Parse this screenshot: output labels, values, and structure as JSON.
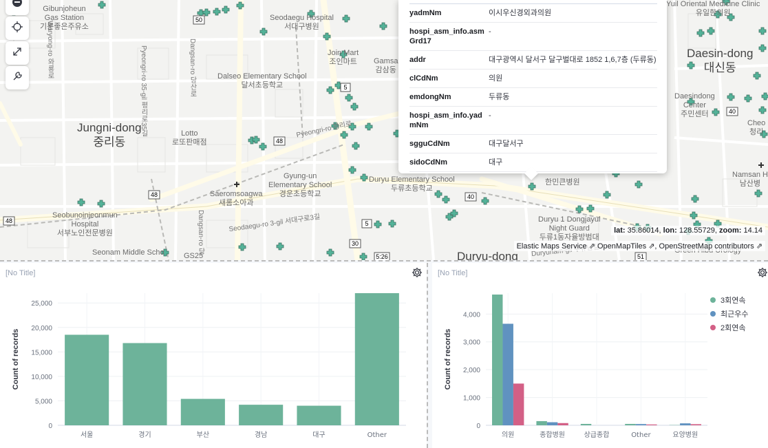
{
  "map": {
    "districts": [
      {
        "id": "jungni",
        "en": "Jungni-dong",
        "ko": "중리동"
      },
      {
        "id": "daesin",
        "en": "Daesin-dong",
        "ko": "대신동"
      },
      {
        "id": "duryu",
        "en": "Duryu-dong",
        "ko": ""
      }
    ],
    "places": [
      {
        "id": "gibunjoheun",
        "text": "Gibunjoheun\nGas Station\n기분좋은주유소"
      },
      {
        "id": "seodaegu-hospital",
        "text": "Seodaegu Hospital\n서대구병원"
      },
      {
        "id": "join-mart",
        "text": "Join Mart\n조인마트"
      },
      {
        "id": "dalseo-elem",
        "text": "Dalseo Elementary School\n달서초등학교"
      },
      {
        "id": "lotto",
        "text": "Lotto\n로또판매점"
      },
      {
        "id": "gyung-un",
        "text": "Gyung-un\nElementary School\n경운초등학교"
      },
      {
        "id": "saeromsoagwa",
        "text": "Saeromsoagwa\n새롬소아과"
      },
      {
        "id": "seobunoin",
        "text": "Seobunoinjeonmun\nHospital\n서부노인전문병원"
      },
      {
        "id": "duryu-elem",
        "text": "Duryu Elementary School\n두류초등학교"
      },
      {
        "id": "seonam",
        "text": "Seonam Middle Scho"
      },
      {
        "id": "gs25",
        "text": "GS25"
      },
      {
        "id": "duryu1-guard",
        "text": "Duryu 1 Dongjayul\nNight Guard\n두류1동자율방범대"
      },
      {
        "id": "daesindong-center",
        "text": "Daesindong\nCenter\n주민센터"
      },
      {
        "id": "namsan",
        "text": "Namsan H\n남산병"
      },
      {
        "id": "oriental",
        "text": "Yuil Oriental Medicine Clinic\n유일한의원"
      },
      {
        "id": "cheon",
        "text": "Cheo\n청리"
      },
      {
        "id": "gamsam",
        "text": "Gamsa\n감삼동"
      },
      {
        "id": "hanmin",
        "text": "한민큰병원"
      },
      {
        "id": "green",
        "text": "Green Hibu Urology"
      }
    ],
    "roads": [
      {
        "id": "pyeongri-ro",
        "text": "Pyeongri-ro 35-gil 평리로35길"
      },
      {
        "id": "dangsan-ro",
        "text": "Dangsan-ro 당산로"
      },
      {
        "id": "waryong-ro",
        "text": "Waryong-ro 와룡로"
      },
      {
        "id": "seodaegu-ro-3gil",
        "text": "Seodaegu-ro 3-gil 서대구로3길"
      },
      {
        "id": "duryunam-gil",
        "text": "Duryunam-gil 두류남길"
      },
      {
        "id": "pyeongri-ro-main",
        "text": "Pyeongri-ro 평리로"
      },
      {
        "id": "dangsan-ro-b",
        "text": "Dangsan-ro 당"
      }
    ],
    "route_shields": [
      "50",
      "48",
      "48",
      "5",
      "5",
      "30",
      "40",
      "40",
      "48",
      "51",
      "5:26"
    ],
    "tooltip": {
      "rows": [
        {
          "key": "yadmNm",
          "value": "이시우신경외과의원"
        },
        {
          "key": "hospi_asm_info.asmGrd17",
          "value": "-"
        },
        {
          "key": "addr",
          "value": "대구광역시 달서구 달구벌대로 1852 1,6,7층 (두류동)"
        },
        {
          "key": "clCdNm",
          "value": "의원"
        },
        {
          "key": "emdongNm",
          "value": "두류동"
        },
        {
          "key": "hospi_asm_info.yadmNm",
          "value": "-"
        },
        {
          "key": "sgguCdNm",
          "value": "대구달서구"
        },
        {
          "key": "sidoCdNm",
          "value": "대구"
        }
      ]
    },
    "coords": {
      "lat_label": "lat:",
      "lat": "35.86014,",
      "lon_label": "lon:",
      "lon": "128.55729,",
      "zoom_label": "zoom:",
      "zoom": "14.14"
    },
    "attribution": [
      "Elastic Maps Service",
      "OpenMapTiles",
      "OpenStreetMap contributors"
    ],
    "controls": [
      "zoom-out-icon",
      "crosshair-icon",
      "expand-icon",
      "wrench-icon"
    ],
    "marker_color": "#54b399"
  },
  "panels": {
    "left": {
      "title": "[No Title]"
    },
    "right": {
      "title": "[No Title]"
    }
  },
  "chart_data": [
    {
      "type": "bar",
      "categories": [
        "서울",
        "경기",
        "부산",
        "경남",
        "대구",
        "Other"
      ],
      "values": [
        18500,
        16800,
        5400,
        4200,
        4000,
        27000
      ],
      "ylabel": "Count of records",
      "xlabel": "",
      "ylim": [
        0,
        27000
      ],
      "yticks": [
        0,
        5000,
        10000,
        15000,
        20000,
        25000
      ],
      "ytick_labels": [
        "0",
        "5,000",
        "10,000",
        "15,000",
        "20,000",
        "25,000"
      ],
      "color": "#6db39a",
      "grid": true
    },
    {
      "type": "bar",
      "categories": [
        "의원",
        "종합병원",
        "상급종합",
        "Other",
        "요양병원"
      ],
      "series": [
        {
          "name": "3회연속",
          "color": "#6db39a",
          "values": [
            4700,
            150,
            50,
            50,
            10
          ]
        },
        {
          "name": "최근우수",
          "color": "#6092c0",
          "values": [
            3650,
            110,
            0,
            45,
            70
          ]
        },
        {
          "name": "2회연속",
          "color": "#d36086",
          "values": [
            1500,
            80,
            0,
            30,
            40
          ]
        }
      ],
      "ylabel": "Count of records",
      "xlabel": "",
      "ylim": [
        0,
        4750
      ],
      "yticks": [
        0,
        1000,
        2000,
        3000,
        4000
      ],
      "ytick_labels": [
        "0",
        "1,000",
        "2,000",
        "3,000",
        "4,000"
      ],
      "legend": "top-right",
      "legend_more": "⋮",
      "grid": true
    }
  ]
}
